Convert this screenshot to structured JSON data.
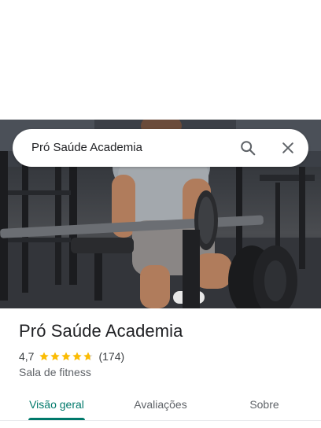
{
  "search": {
    "query": "Pró Saúde Academia"
  },
  "place": {
    "name": "Pró Saúde Academia",
    "rating": "4,7",
    "rating_value": 4.7,
    "reviews": "(174)",
    "category": "Sala de fitness"
  },
  "tabs": [
    {
      "label": "Visão geral",
      "active": true
    },
    {
      "label": "Avaliações",
      "active": false
    },
    {
      "label": "Sobre",
      "active": false
    }
  ],
  "colors": {
    "accent": "#00796b",
    "star": "#fbbc04"
  },
  "icons": {
    "search": "search-icon",
    "close": "close-icon",
    "star": "star-icon"
  }
}
